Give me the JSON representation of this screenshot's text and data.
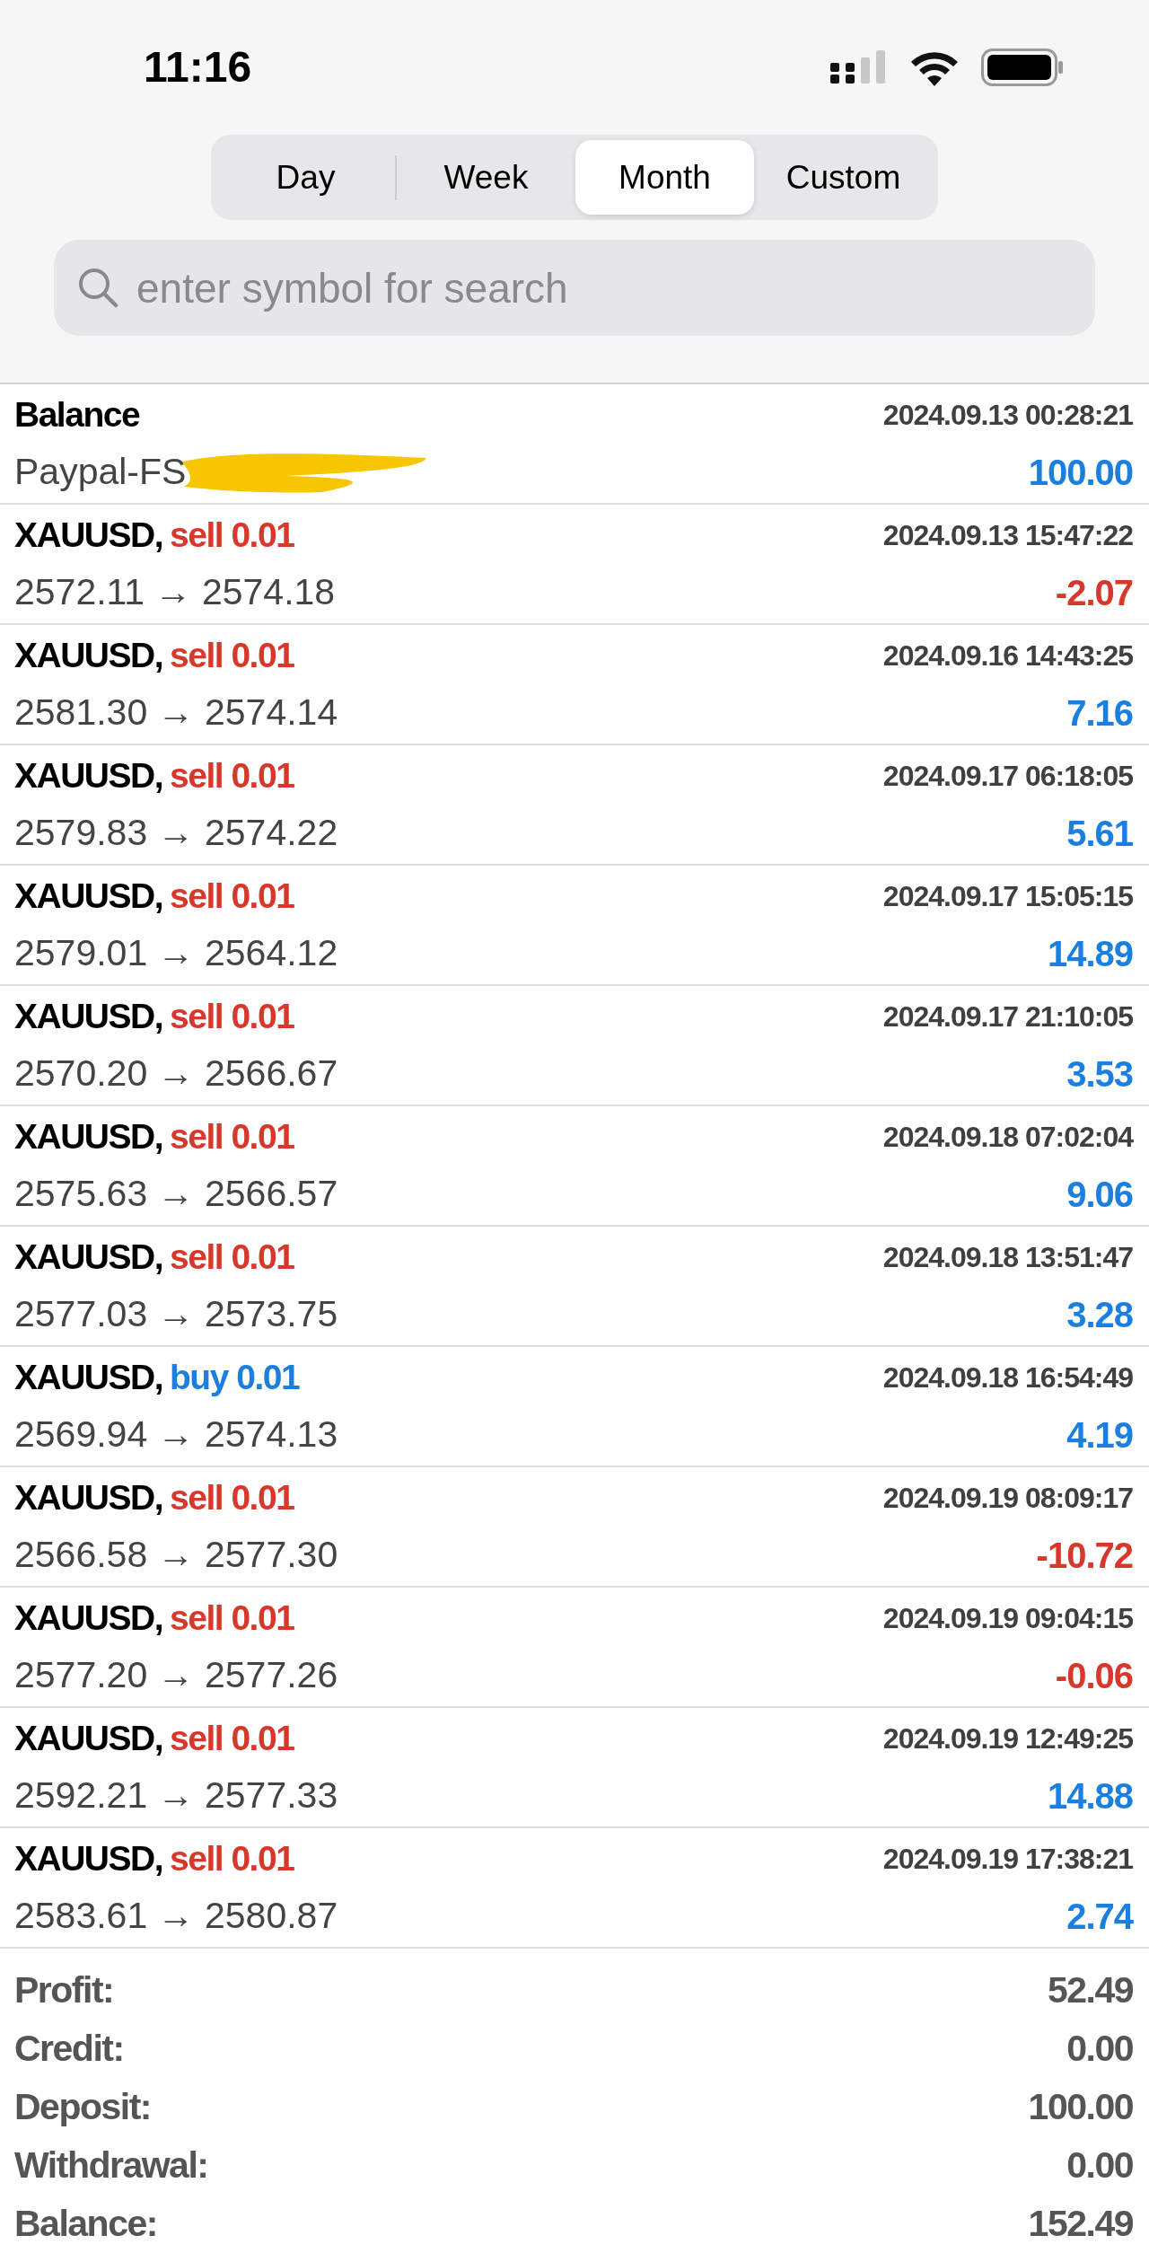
{
  "status_bar": {
    "time": "11:16"
  },
  "tabs": [
    {
      "label": "Day",
      "selected": false
    },
    {
      "label": "Week",
      "selected": false
    },
    {
      "label": "Month",
      "selected": true
    },
    {
      "label": "Custom",
      "selected": false
    }
  ],
  "search": {
    "placeholder": "enter symbol for search"
  },
  "balance_entry": {
    "title": "Balance",
    "time": "2024.09.13 00:28:21",
    "comment": "Paypal-FS",
    "redacted": true,
    "amount": "100.00"
  },
  "trades": [
    {
      "symbol": "XAUUSD,",
      "kind": "sell",
      "order": "sell 0.01",
      "time": "2024.09.13 15:47:22",
      "prices": "2572.11 → 2574.18",
      "profit": "-2.07",
      "loss": true
    },
    {
      "symbol": "XAUUSD,",
      "kind": "sell",
      "order": "sell 0.01",
      "time": "2024.09.16 14:43:25",
      "prices": "2581.30 → 2574.14",
      "profit": "7.16",
      "loss": false
    },
    {
      "symbol": "XAUUSD,",
      "kind": "sell",
      "order": "sell 0.01",
      "time": "2024.09.17 06:18:05",
      "prices": "2579.83 → 2574.22",
      "profit": "5.61",
      "loss": false
    },
    {
      "symbol": "XAUUSD,",
      "kind": "sell",
      "order": "sell 0.01",
      "time": "2024.09.17 15:05:15",
      "prices": "2579.01 → 2564.12",
      "profit": "14.89",
      "loss": false
    },
    {
      "symbol": "XAUUSD,",
      "kind": "sell",
      "order": "sell 0.01",
      "time": "2024.09.17 21:10:05",
      "prices": "2570.20 → 2566.67",
      "profit": "3.53",
      "loss": false
    },
    {
      "symbol": "XAUUSD,",
      "kind": "sell",
      "order": "sell 0.01",
      "time": "2024.09.18 07:02:04",
      "prices": "2575.63 → 2566.57",
      "profit": "9.06",
      "loss": false
    },
    {
      "symbol": "XAUUSD,",
      "kind": "sell",
      "order": "sell 0.01",
      "time": "2024.09.18 13:51:47",
      "prices": "2577.03 → 2573.75",
      "profit": "3.28",
      "loss": false
    },
    {
      "symbol": "XAUUSD,",
      "kind": "buy",
      "order": "buy 0.01",
      "time": "2024.09.18 16:54:49",
      "prices": "2569.94 → 2574.13",
      "profit": "4.19",
      "loss": false
    },
    {
      "symbol": "XAUUSD,",
      "kind": "sell",
      "order": "sell 0.01",
      "time": "2024.09.19 08:09:17",
      "prices": "2566.58 → 2577.30",
      "profit": "-10.72",
      "loss": true
    },
    {
      "symbol": "XAUUSD,",
      "kind": "sell",
      "order": "sell 0.01",
      "time": "2024.09.19 09:04:15",
      "prices": "2577.20 → 2577.26",
      "profit": "-0.06",
      "loss": true
    },
    {
      "symbol": "XAUUSD,",
      "kind": "sell",
      "order": "sell 0.01",
      "time": "2024.09.19 12:49:25",
      "prices": "2592.21 → 2577.33",
      "profit": "14.88",
      "loss": false
    },
    {
      "symbol": "XAUUSD,",
      "kind": "sell",
      "order": "sell 0.01",
      "time": "2024.09.19 17:38:21",
      "prices": "2583.61 → 2580.87",
      "profit": "2.74",
      "loss": false
    }
  ],
  "summary": [
    {
      "label": "Profit:",
      "value": "52.49"
    },
    {
      "label": "Credit:",
      "value": "0.00"
    },
    {
      "label": "Deposit:",
      "value": "100.00"
    },
    {
      "label": "Withdrawal:",
      "value": "0.00"
    },
    {
      "label": "Balance:",
      "value": "152.49"
    }
  ]
}
